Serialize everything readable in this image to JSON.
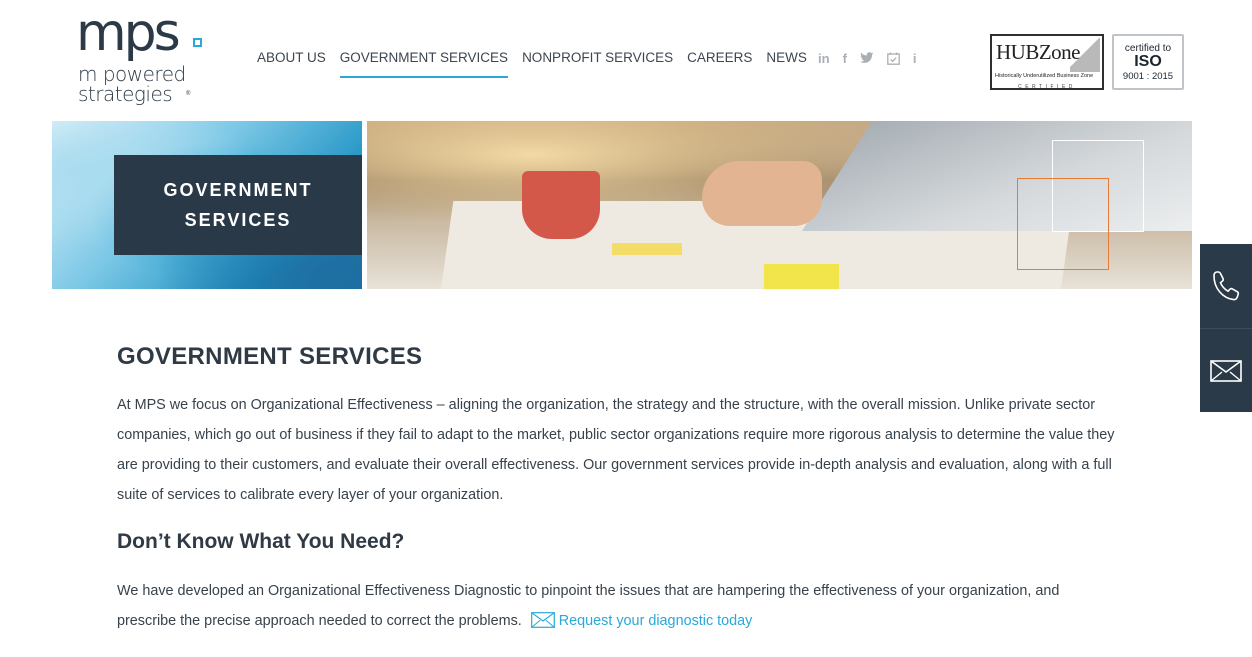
{
  "brand": {
    "mark": "mps",
    "line1": "m powered",
    "line2": "strategies",
    "reg": "®",
    "accent_color": "#2aa8d8",
    "dark_color": "#2a3948"
  },
  "nav": {
    "items": [
      {
        "label": "ABOUT US",
        "active": false
      },
      {
        "label": "GOVERNMENT SERVICES",
        "active": true
      },
      {
        "label": "NONPROFIT SERVICES",
        "active": false
      },
      {
        "label": "CAREERS",
        "active": false
      },
      {
        "label": "NEWS",
        "active": false
      }
    ]
  },
  "social": {
    "icons": [
      {
        "name": "linkedin-icon",
        "glyph": "in"
      },
      {
        "name": "facebook-icon",
        "glyph": "f"
      },
      {
        "name": "twitter-icon",
        "glyph": "🐦"
      },
      {
        "name": "calendar-icon",
        "glyph": "☑"
      },
      {
        "name": "info-icon",
        "glyph": "i"
      }
    ]
  },
  "badges": {
    "hubzone": {
      "title": "HUBZone",
      "subtitle": "Historically Underutilized Business Zone",
      "certified": "CERTIFIED"
    },
    "iso": {
      "line1": "certified to",
      "line2": "ISO",
      "line3": "9001 : 2015"
    }
  },
  "banner": {
    "title_line1": "GOVERNMENT",
    "title_line2": "SERVICES"
  },
  "side_contact": {
    "icons": [
      "phone-icon",
      "mail-icon"
    ]
  },
  "content": {
    "heading": "GOVERNMENT SERVICES",
    "intro": "At MPS we focus on Organizational Effectiveness – aligning the organization, the strategy and the structure, with the overall mission. Unlike private sector companies, which go out of business if they fail to adapt to the market, public sector organizations require more rigorous analysis to determine the value they are providing to their customers, and evaluate their overall effectiveness. Our government services provide in-depth analysis and evaluation, along with a full suite of services to calibrate every layer of your organization.",
    "subheading": "Don’t Know What You Need?",
    "diagnostic_text": "We have developed an Organizational Effectiveness Diagnostic to pinpoint the issues that are hampering the effectiveness of your organization, and prescribe the precise approach needed to correct the problems.",
    "diagnostic_link": "Request your diagnostic today"
  }
}
